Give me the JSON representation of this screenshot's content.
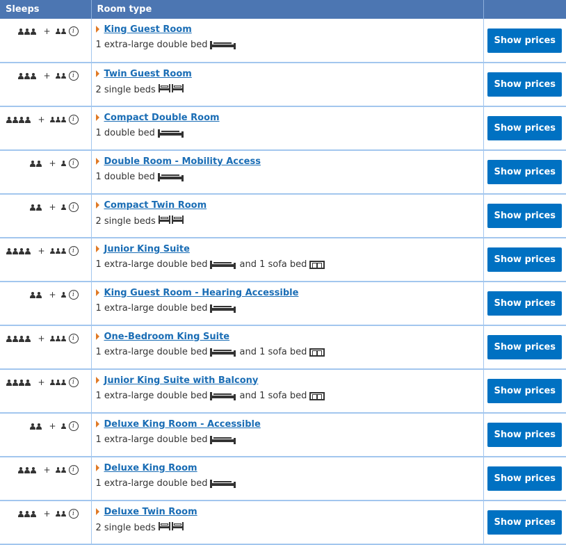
{
  "header": {
    "col_sleeps": "Sleeps",
    "col_room_type": "Room type",
    "col_action": ""
  },
  "plus_sign": "+",
  "info_glyph": "i",
  "rows": [
    {
      "adults": 3,
      "children": 2,
      "room_name": "King Guest Room",
      "beds": [
        {
          "text": "1 extra-large double bed",
          "icon": "double-bed-icon"
        }
      ]
    },
    {
      "adults": 3,
      "children": 2,
      "room_name": "Twin Guest Room",
      "beds": [
        {
          "text": "2 single beds",
          "icon": "two-single-beds-icon"
        }
      ]
    },
    {
      "adults": 4,
      "children": 3,
      "room_name": "Compact Double Room",
      "beds": [
        {
          "text": "1 double bed",
          "icon": "double-bed-icon"
        }
      ]
    },
    {
      "adults": 2,
      "children": 1,
      "room_name": "Double Room - Mobility Access",
      "beds": [
        {
          "text": "1 double bed",
          "icon": "double-bed-icon"
        }
      ]
    },
    {
      "adults": 2,
      "children": 1,
      "room_name": "Compact Twin Room",
      "beds": [
        {
          "text": "2 single beds",
          "icon": "two-single-beds-icon"
        }
      ]
    },
    {
      "adults": 4,
      "children": 3,
      "room_name": "Junior King Suite",
      "beds": [
        {
          "text": "1 extra-large double bed",
          "icon": "double-bed-icon"
        },
        {
          "text": "and 1 sofa bed",
          "icon": "sofa-bed-icon"
        }
      ]
    },
    {
      "adults": 2,
      "children": 1,
      "room_name": "King Guest Room - Hearing Accessible",
      "beds": [
        {
          "text": "1 extra-large double bed",
          "icon": "double-bed-icon"
        }
      ]
    },
    {
      "adults": 4,
      "children": 3,
      "room_name": "One-Bedroom King Suite",
      "beds": [
        {
          "text": "1 extra-large double bed",
          "icon": "double-bed-icon"
        },
        {
          "text": "and 1 sofa bed",
          "icon": "sofa-bed-icon"
        }
      ]
    },
    {
      "adults": 4,
      "children": 3,
      "room_name": "Junior King Suite with Balcony",
      "beds": [
        {
          "text": "1 extra-large double bed",
          "icon": "double-bed-icon"
        },
        {
          "text": "and 1 sofa bed",
          "icon": "sofa-bed-icon"
        }
      ]
    },
    {
      "adults": 2,
      "children": 1,
      "room_name": "Deluxe King Room - Accessible",
      "beds": [
        {
          "text": "1 extra-large double bed",
          "icon": "double-bed-icon"
        }
      ]
    },
    {
      "adults": 3,
      "children": 2,
      "room_name": "Deluxe King Room",
      "beds": [
        {
          "text": "1 extra-large double bed",
          "icon": "double-bed-icon"
        }
      ]
    },
    {
      "adults": 3,
      "children": 2,
      "room_name": "Deluxe Twin Room",
      "beds": [
        {
          "text": "2 single beds",
          "icon": "two-single-beds-icon"
        }
      ]
    }
  ],
  "button_label": "Show prices",
  "colors": {
    "header_bg": "#4c76b2",
    "link": "#1a6db5",
    "button": "#0071c2",
    "accent_triangle": "#e07a26",
    "row_border": "#a2c6ee"
  }
}
